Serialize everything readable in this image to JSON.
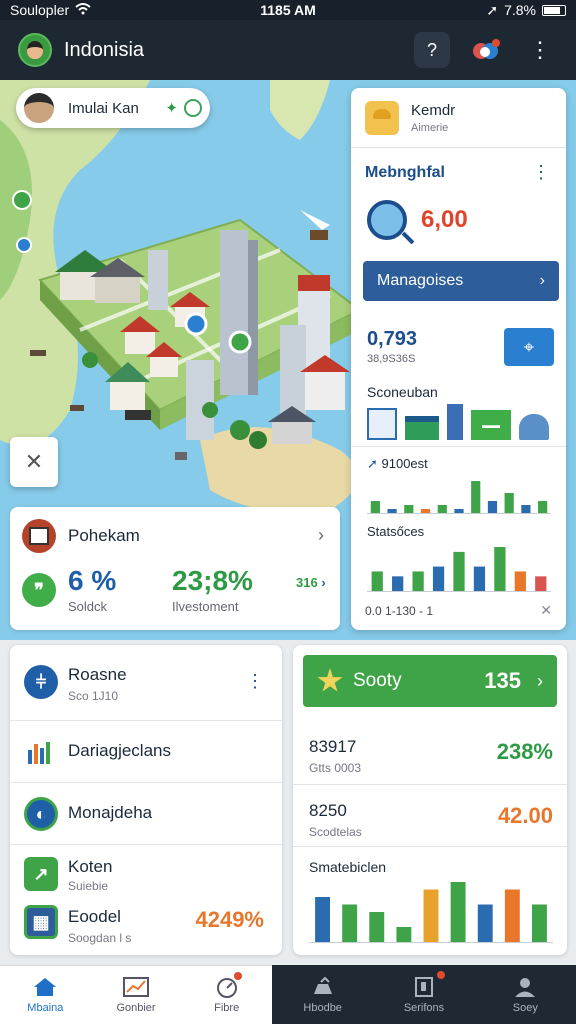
{
  "status_bar": {
    "carrier": "Soulopler",
    "time": "1185 AM",
    "battery": "7.8%"
  },
  "app_bar": {
    "title": "Indonisia",
    "help_icon": "?"
  },
  "map": {
    "location_chip": {
      "name": "Imulai Kan"
    }
  },
  "side_panel": {
    "header": {
      "title": "Kemdr",
      "subtitle": "Aimerie"
    },
    "section_title": "Mebnghfal",
    "search_value": "6,00",
    "manage_button": "Managoises",
    "count": "0,793",
    "count_sub": "38,9S36S",
    "row_title": "Sconeuban",
    "stat_title": "9100est",
    "stats_title": "Statsőces",
    "footer": "0.0  1-130 -  1",
    "chart_top": {
      "values": [
        3,
        1,
        2,
        1,
        2,
        1,
        8,
        3,
        5,
        2,
        3
      ],
      "colors": [
        "#3fa447",
        "#2b6cb0",
        "#3fa447",
        "#e8762b",
        "#3fa447",
        "#2b6cb0",
        "#3fa447",
        "#2b6cb0",
        "#3fa447",
        "#2b6cb0",
        "#3fa447"
      ]
    },
    "chart_bottom": {
      "values": [
        4,
        3,
        4,
        5,
        8,
        5,
        9,
        4,
        3
      ],
      "colors": [
        "#3fa447",
        "#2b6cb0",
        "#3fa447",
        "#2b6cb0",
        "#3fa447",
        "#2b6cb0",
        "#3fa447",
        "#e8762b",
        "#d9534f"
      ]
    }
  },
  "summary_card": {
    "title": "Pohekam",
    "percent": "6 %",
    "percent_label": "Soldck",
    "big_value": "23;8%",
    "big_label": "Ilvestoment",
    "mini_value": "316",
    "mini_arrow": "›"
  },
  "list_card": {
    "rows": [
      {
        "title": "Roasne",
        "sub": "Sco 1J10"
      },
      {
        "title": "Dariagjeclans",
        "sub": ""
      },
      {
        "title": "Monajdeha",
        "sub": ""
      },
      {
        "title": "Koten",
        "sub": "Suiebie"
      },
      {
        "title": "Eoodel",
        "sub": "Soogdan l s",
        "value": "4249%"
      }
    ]
  },
  "score_card": {
    "button_label": "Sooty",
    "button_value": "135",
    "rows": [
      {
        "value": "83917",
        "sub": "Gtts 0003",
        "pct": "238%",
        "color": "#2f9a45"
      },
      {
        "value": "8250",
        "sub": "Scodtelas",
        "pct": "42.00",
        "color": "#e8762b"
      }
    ],
    "chart_title": "Smatebiclen",
    "chart": {
      "values": [
        6,
        5,
        4,
        2,
        7,
        8,
        5,
        7,
        5
      ],
      "colors": [
        "#2b6cb0",
        "#3fa447",
        "#3fa447",
        "#3fa447",
        "#e8a22b",
        "#3fa447",
        "#2b6cb0",
        "#e8762b",
        "#3fa447"
      ]
    }
  },
  "bottom_nav": {
    "items": [
      {
        "label": "Mbaina",
        "active": true
      },
      {
        "label": "Gonbier"
      },
      {
        "label": "Fibre"
      },
      {
        "label": "Hbodbe"
      },
      {
        "label": "Serifons"
      },
      {
        "label": "Soey"
      }
    ]
  }
}
